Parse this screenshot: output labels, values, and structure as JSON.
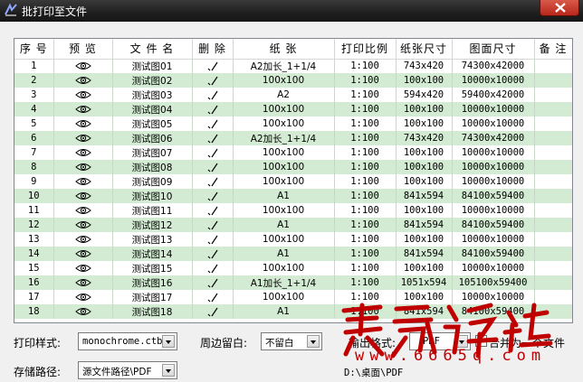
{
  "window": {
    "title": "批打印至文件"
  },
  "table": {
    "columns": [
      "序 号",
      "预 览",
      "文 件 名",
      "删 除",
      "纸 张",
      "打印比例",
      "纸张尺寸",
      "图面尺寸",
      "备 注"
    ],
    "rows": [
      {
        "no": "1",
        "name": "测试图01",
        "paper": "A2加长_1+1/4",
        "scale": "1:100",
        "paper_size": "743x420",
        "drawing_size": "74300x42000",
        "note": ""
      },
      {
        "no": "2",
        "name": "测试图02",
        "paper": "100x100",
        "scale": "1:100",
        "paper_size": "100x100",
        "drawing_size": "10000x10000",
        "note": ""
      },
      {
        "no": "3",
        "name": "测试图03",
        "paper": "A2",
        "scale": "1:100",
        "paper_size": "594x420",
        "drawing_size": "59400x42000",
        "note": ""
      },
      {
        "no": "4",
        "name": "测试图04",
        "paper": "100x100",
        "scale": "1:100",
        "paper_size": "100x100",
        "drawing_size": "10000x10000",
        "note": ""
      },
      {
        "no": "5",
        "name": "测试图05",
        "paper": "100x100",
        "scale": "1:100",
        "paper_size": "100x100",
        "drawing_size": "10000x10000",
        "note": ""
      },
      {
        "no": "6",
        "name": "测试图06",
        "paper": "A2加长_1+1/4",
        "scale": "1:100",
        "paper_size": "743x420",
        "drawing_size": "74300x42000",
        "note": ""
      },
      {
        "no": "7",
        "name": "测试图07",
        "paper": "100x100",
        "scale": "1:100",
        "paper_size": "100x100",
        "drawing_size": "10000x10000",
        "note": ""
      },
      {
        "no": "8",
        "name": "测试图08",
        "paper": "100x100",
        "scale": "1:100",
        "paper_size": "100x100",
        "drawing_size": "10000x10000",
        "note": ""
      },
      {
        "no": "9",
        "name": "测试图09",
        "paper": "100x100",
        "scale": "1:100",
        "paper_size": "100x100",
        "drawing_size": "10000x10000",
        "note": ""
      },
      {
        "no": "10",
        "name": "测试图10",
        "paper": "A1",
        "scale": "1:100",
        "paper_size": "841x594",
        "drawing_size": "84100x59400",
        "note": ""
      },
      {
        "no": "11",
        "name": "测试图11",
        "paper": "100x100",
        "scale": "1:100",
        "paper_size": "100x100",
        "drawing_size": "10000x10000",
        "note": ""
      },
      {
        "no": "12",
        "name": "测试图12",
        "paper": "A1",
        "scale": "1:100",
        "paper_size": "841x594",
        "drawing_size": "84100x59400",
        "note": ""
      },
      {
        "no": "13",
        "name": "测试图13",
        "paper": "100x100",
        "scale": "1:100",
        "paper_size": "100x100",
        "drawing_size": "10000x10000",
        "note": ""
      },
      {
        "no": "14",
        "name": "测试图14",
        "paper": "A1",
        "scale": "1:100",
        "paper_size": "841x594",
        "drawing_size": "84100x59400",
        "note": ""
      },
      {
        "no": "15",
        "name": "测试图15",
        "paper": "100x100",
        "scale": "1:100",
        "paper_size": "100x100",
        "drawing_size": "10000x10000",
        "note": ""
      },
      {
        "no": "16",
        "name": "测试图16",
        "paper": "A1加长_1+1/4",
        "scale": "1:100",
        "paper_size": "1051x594",
        "drawing_size": "105100x59400",
        "note": ""
      },
      {
        "no": "17",
        "name": "测试图17",
        "paper": "100x100",
        "scale": "1:100",
        "paper_size": "100x100",
        "drawing_size": "10000x10000",
        "note": ""
      },
      {
        "no": "18",
        "name": "测试图18",
        "paper": "A1",
        "scale": "1:100",
        "paper_size": "841x594",
        "drawing_size": "84100x59400",
        "note": ""
      }
    ]
  },
  "controls": {
    "plot_style_label": "打印样式:",
    "plot_style_value": "monochrome.ctb",
    "margin_label": "周边留白:",
    "margin_value": "不留白",
    "output_format_label": "输出格式:",
    "output_format_value": "PDF",
    "merge_label": "合并为一个文件",
    "merge_checked": false,
    "save_path_label": "存储路径:",
    "save_path_value": "源文件路径\\PDF",
    "save_path_text": "D:\\桌面\\PDF"
  },
  "watermark": {
    "text": "灵感论坛",
    "url": "www.6665q.com"
  },
  "colors": {
    "row_alt": "#d3ebd3",
    "titlebar": "#1e1e1e",
    "close": "#c0392b",
    "watermark": "#c00000"
  }
}
